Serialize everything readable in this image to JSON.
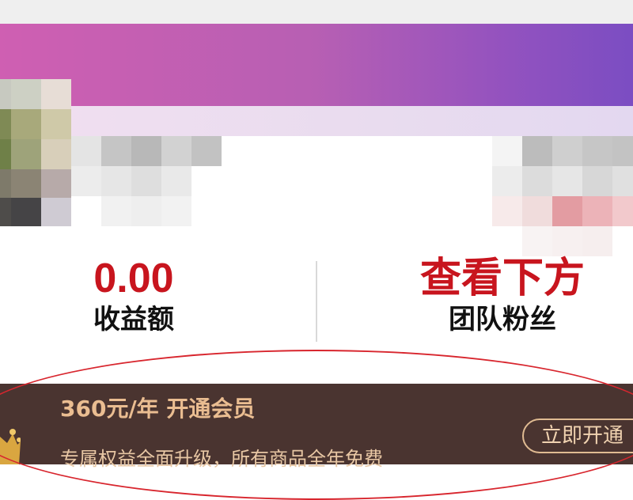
{
  "stats": {
    "earnings": {
      "value": "0.00",
      "label": "收益额"
    },
    "team": {
      "value": "查看下方",
      "label": "团队粉丝"
    }
  },
  "membership": {
    "title": "360元/年 开通会员",
    "subtitle": "专属权益全面升级，所有商品全年免费",
    "button_label": "立即开通"
  },
  "colors": {
    "accent_red": "#c8151e",
    "card_bg": "#4a3430",
    "gold_text": "#eabd91",
    "banner_start": "#cf5fb2",
    "banner_end": "#7b4dc2"
  },
  "icons": {
    "crown": "crown-icon"
  }
}
